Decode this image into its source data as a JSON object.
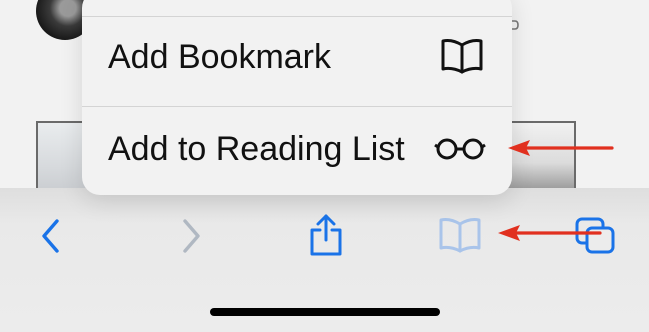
{
  "colors": {
    "accent": "#1a73e8",
    "disabled": "#b0b8c2",
    "arrow": "#e1301f",
    "text": "#111111"
  },
  "menu": {
    "items": [
      {
        "label": "Add Bookmark",
        "icon": "book-icon"
      },
      {
        "label": "Add to Reading List",
        "icon": "glasses-icon"
      }
    ]
  },
  "toolbar": {
    "buttons": [
      {
        "name": "back",
        "icon": "chevron-left-icon",
        "enabled": true
      },
      {
        "name": "forward",
        "icon": "chevron-right-icon",
        "enabled": false
      },
      {
        "name": "share",
        "icon": "share-icon",
        "enabled": true
      },
      {
        "name": "bookmarks",
        "icon": "book-icon",
        "enabled": true
      },
      {
        "name": "tabs",
        "icon": "tabs-icon",
        "enabled": true
      }
    ]
  }
}
